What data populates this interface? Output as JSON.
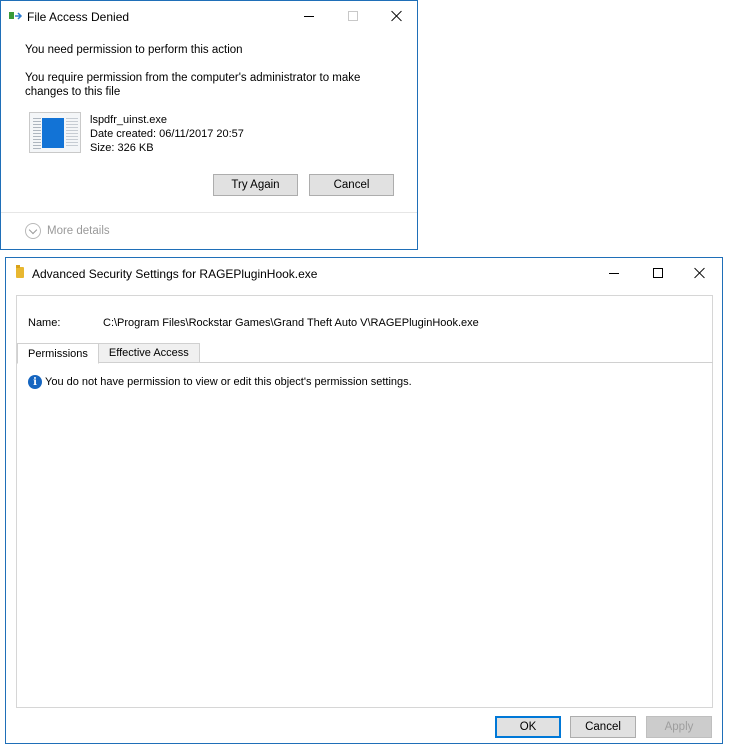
{
  "dialog1": {
    "title": "File Access Denied",
    "heading": "You need permission to perform this action",
    "message_line1": "You require permission from the computer's administrator to make",
    "message_line2": "changes to this file",
    "file": {
      "name": "lspdfr_uinst.exe",
      "date_created": "Date created: 06/11/2017 20:57",
      "size": "Size: 326 KB"
    },
    "buttons": {
      "try_again": "Try Again",
      "cancel": "Cancel"
    },
    "more_details": "More details"
  },
  "dialog2": {
    "title": "Advanced Security Settings for RAGEPluginHook.exe",
    "name_label": "Name:",
    "name_value": "C:\\Program Files\\Rockstar Games\\Grand Theft Auto V\\RAGEPluginHook.exe",
    "tabs": [
      {
        "label": "Permissions"
      },
      {
        "label": "Effective Access"
      }
    ],
    "info_message": "You do not have permission to view or edit this object's permission settings.",
    "buttons": {
      "ok": "OK",
      "cancel": "Cancel",
      "apply": "Apply"
    }
  },
  "colors": {
    "window_border": "#1f6fb8",
    "default_button_border": "#0078d7",
    "info_icon": "#1565c0"
  }
}
